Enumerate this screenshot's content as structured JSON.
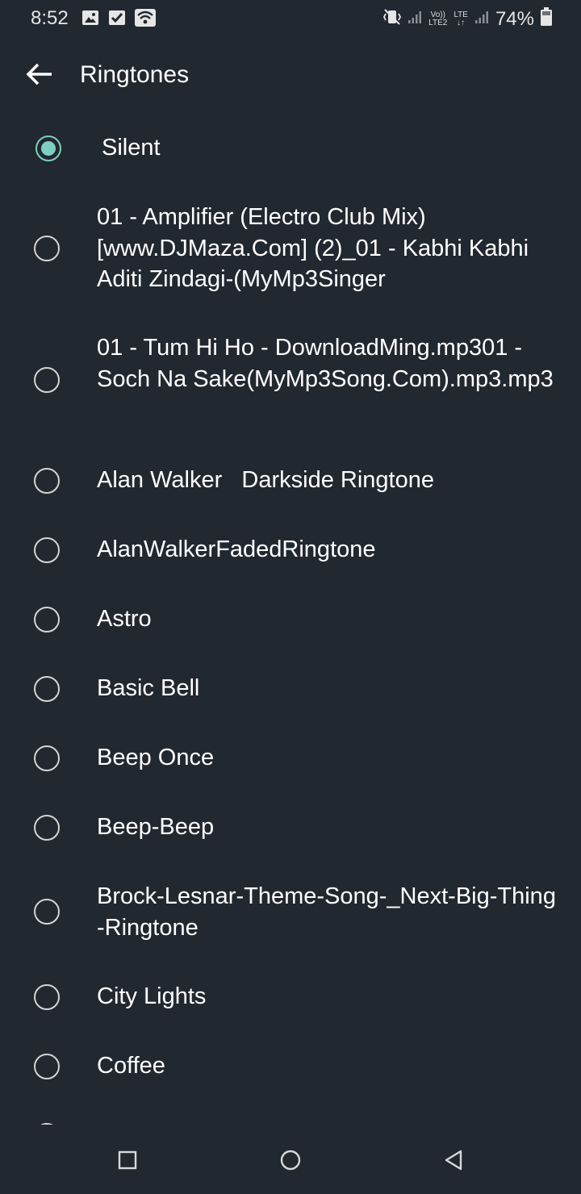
{
  "status_bar": {
    "time": "8:52",
    "battery": "74%",
    "volte_top": "Vo))",
    "volte_bottom": "LTE2",
    "lte_top": "LTE",
    "lte_bottom": "↓↑",
    "icons": [
      "image-icon",
      "checkbox-icon",
      "wifi-icon",
      "vibrate-icon",
      "signal-icon",
      "signal-icon",
      "battery-icon"
    ]
  },
  "app_bar": {
    "title": "Ringtones"
  },
  "ringtones": [
    {
      "label": "Silent",
      "selected": true
    },
    {
      "label": "01 - Amplifier (Electro Club Mix) [www.DJMaza.Com] (2)_01 - Kabhi Kabhi Aditi Zindagi-(MyMp3Singer",
      "selected": false
    },
    {
      "label": "01 - Tum Hi Ho - DownloadMing.mp301 - Soch Na Sake(MyMp3Song.Com).mp3.mp3",
      "selected": false
    },
    {
      "label": "Alan Walker   Darkside Ringtone",
      "selected": false
    },
    {
      "label": "AlanWalkerFadedRingtone",
      "selected": false
    },
    {
      "label": "Astro",
      "selected": false
    },
    {
      "label": "Basic Bell",
      "selected": false
    },
    {
      "label": "Beep Once",
      "selected": false
    },
    {
      "label": "Beep-Beep",
      "selected": false
    },
    {
      "label": "Brock-Lesnar-Theme-Song-_Next-Big-Thing-Ringtone",
      "selected": false
    },
    {
      "label": "City Lights",
      "selected": false
    },
    {
      "label": "Coffee",
      "selected": false
    }
  ],
  "nav_bar": {
    "icons": [
      "recents-icon",
      "home-icon",
      "back-icon"
    ]
  },
  "colors": {
    "background": "#222830",
    "accent": "#7ecfc3",
    "text": "#ffffff"
  }
}
